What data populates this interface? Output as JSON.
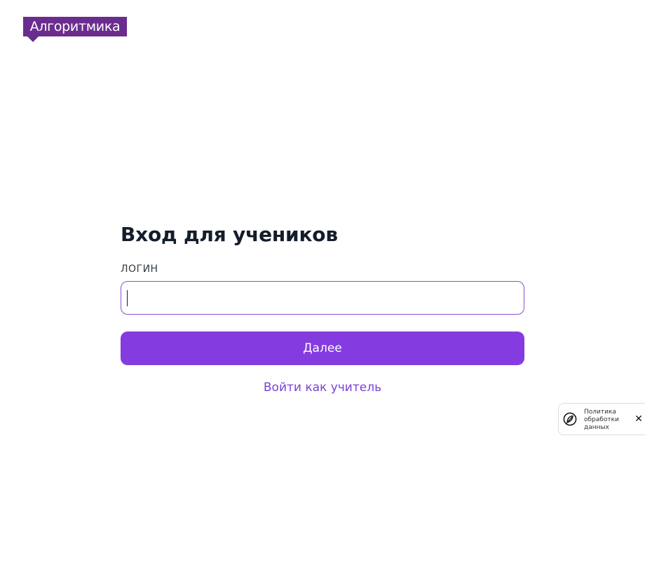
{
  "brand": {
    "logo_text": "Алгоритмика",
    "color": "#6a2c8f"
  },
  "login_form": {
    "title": "Вход для учеников",
    "login_label": "ЛОГИН",
    "login_value": "",
    "login_placeholder": "",
    "next_button_label": "Далее",
    "teacher_link_label": "Войти как учитель",
    "accent_color": "#843ce0"
  },
  "policy_widget": {
    "text_line1": "Политика",
    "text_line2": "обработки",
    "text_line3": "данных",
    "icon": "policy-leaf-icon",
    "close_icon": "close-icon"
  }
}
